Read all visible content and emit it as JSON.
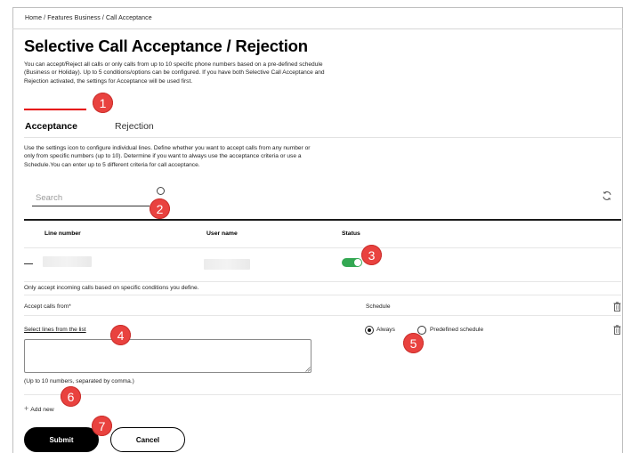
{
  "breadcrumb": {
    "text": "Home  /  Features Business  /  Call Acceptance"
  },
  "page": {
    "title": "Selective Call Acceptance / Rejection",
    "intro": "You can accept/Reject all calls or only calls from up to 10 specific phone numbers based on a pre-defined schedule (Business or Holiday). Up to 5 conditions/options can be configured. If you have both Selective Call Acceptance and Rejection activated, the settings for Acceptance will be used first."
  },
  "tabs": [
    {
      "label": "Acceptance",
      "active": true
    },
    {
      "label": "Rejection",
      "active": false
    }
  ],
  "acceptance": {
    "description": "Use the settings icon to configure individual lines. Define whether you want to accept calls from any number or only from specific numbers (up to 10). Determine if you want to always use the acceptance criteria or use a Schedule.You can enter up to 5 different criteria for call acceptance."
  },
  "search": {
    "placeholder": "Search",
    "icon": "search-icon",
    "refresh_icon": "refresh-icon"
  },
  "table": {
    "headers": [
      "Line number",
      "User name",
      "Status"
    ],
    "rows": [
      {
        "status_on": true
      }
    ]
  },
  "condition": {
    "only_text": "Only accept incoming calls based on specific conditions you define.",
    "accept_from_label": "Accept calls from*",
    "schedule_label": "Schedule",
    "select_link": "Select lines from the list",
    "schedule_options": [
      {
        "label": "Always",
        "selected": true
      },
      {
        "label": "Predefined schedule",
        "selected": false
      }
    ],
    "numbers_value": "",
    "hint": "(Up to 10 numbers, separated by comma.)"
  },
  "add_new": {
    "icon": "plus",
    "label": "Add new"
  },
  "buttons": {
    "submit": "Submit",
    "cancel": "Cancel"
  },
  "markers": [
    "1",
    "2",
    "3",
    "4",
    "5",
    "6",
    "7"
  ],
  "colors": {
    "accent_red": "#e60000",
    "toggle_green": "#34a853",
    "marker_red": "#e9423f",
    "primary_button": "#000000"
  }
}
